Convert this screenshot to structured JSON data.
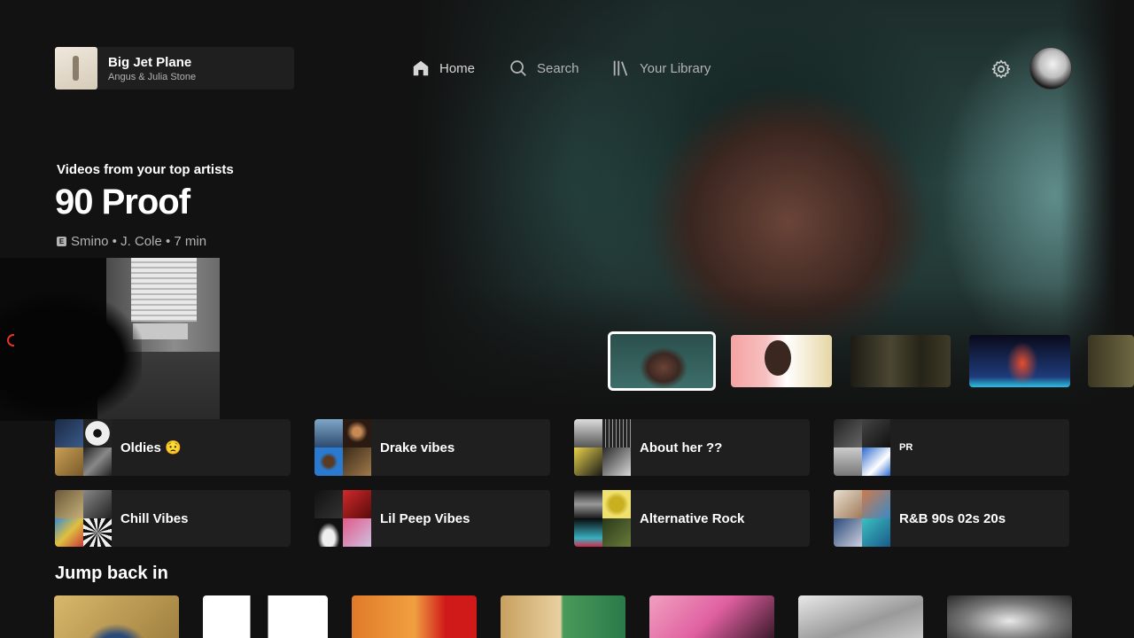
{
  "now_playing": {
    "title": "Big Jet Plane",
    "artist": "Angus & Julia Stone"
  },
  "nav": {
    "home": "Home",
    "search": "Search",
    "library": "Your Library"
  },
  "hero": {
    "kicker": "Videos from your top artists",
    "title": "90 Proof",
    "explicit_glyph": "E",
    "meta": "Smino • J. Cole • 7 min"
  },
  "shortcuts": [
    {
      "label": "Oldies 😟"
    },
    {
      "label": "Drake vibes"
    },
    {
      "label": "About her ??"
    },
    {
      "label": "PR"
    },
    {
      "label": "Chill Vibes"
    },
    {
      "label": "Lil Peep Vibes"
    },
    {
      "label": "Alternative Rock"
    },
    {
      "label": "R&B 90s 02s 20s"
    }
  ],
  "jump_back_in": {
    "title": "Jump back in"
  },
  "colors": {
    "background": "#121212",
    "card": "#1f1f1f",
    "text_secondary": "#b3b3b3"
  }
}
